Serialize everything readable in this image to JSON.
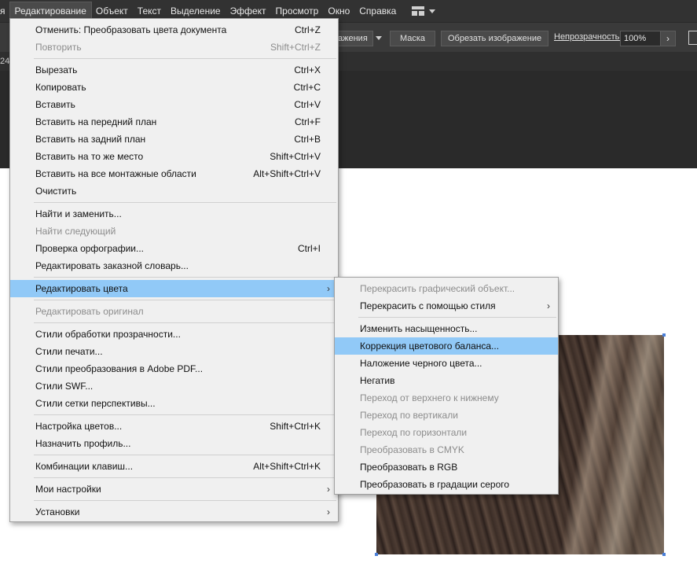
{
  "menubar": {
    "items": [
      "я",
      "Редактирование",
      "Объект",
      "Текст",
      "Выделение",
      "Эффект",
      "Просмотр",
      "Окно",
      "Справка"
    ],
    "active_index": 1
  },
  "controlbar": {
    "partial_button": "ажения",
    "mask_button": "Маска",
    "crop_button": "Обрезать изображение",
    "opacity_label": "Непрозрачность:",
    "opacity_value": "100%",
    "arrow": "›"
  },
  "tabstrip": {
    "partial_text": "24"
  },
  "edit_menu": {
    "items": [
      {
        "label": "Отменить: Преобразовать цвета документа",
        "shortcut": "Ctrl+Z"
      },
      {
        "label": "Повторить",
        "shortcut": "Shift+Ctrl+Z",
        "disabled": true
      },
      {
        "sep": true
      },
      {
        "label": "Вырезать",
        "shortcut": "Ctrl+X"
      },
      {
        "label": "Копировать",
        "shortcut": "Ctrl+C"
      },
      {
        "label": "Вставить",
        "shortcut": "Ctrl+V"
      },
      {
        "label": "Вставить на передний план",
        "shortcut": "Ctrl+F"
      },
      {
        "label": "Вставить на задний план",
        "shortcut": "Ctrl+B"
      },
      {
        "label": "Вставить на то же место",
        "shortcut": "Shift+Ctrl+V"
      },
      {
        "label": "Вставить на все монтажные области",
        "shortcut": "Alt+Shift+Ctrl+V"
      },
      {
        "label": "Очистить",
        "shortcut": ""
      },
      {
        "sep": true
      },
      {
        "label": "Найти и заменить...",
        "shortcut": ""
      },
      {
        "label": "Найти следующий",
        "shortcut": "",
        "disabled": true
      },
      {
        "label": "Проверка орфографии...",
        "shortcut": "Ctrl+I"
      },
      {
        "label": "Редактировать заказной словарь...",
        "shortcut": ""
      },
      {
        "sep": true
      },
      {
        "label": "Редактировать цвета",
        "shortcut": "",
        "submenu": true,
        "highlighted": true
      },
      {
        "sep": true
      },
      {
        "label": "Редактировать оригинал",
        "shortcut": "",
        "disabled": true
      },
      {
        "sep": true
      },
      {
        "label": "Стили обработки прозрачности...",
        "shortcut": ""
      },
      {
        "label": "Стили печати...",
        "shortcut": ""
      },
      {
        "label": "Стили преобразования в Adobe PDF...",
        "shortcut": ""
      },
      {
        "label": "Стили SWF...",
        "shortcut": ""
      },
      {
        "label": "Стили сетки перспективы...",
        "shortcut": ""
      },
      {
        "sep": true
      },
      {
        "label": "Настройка цветов...",
        "shortcut": "Shift+Ctrl+K"
      },
      {
        "label": "Назначить профиль...",
        "shortcut": ""
      },
      {
        "sep": true
      },
      {
        "label": "Комбинации клавиш...",
        "shortcut": "Alt+Shift+Ctrl+K"
      },
      {
        "sep": true
      },
      {
        "label": "Мои настройки",
        "shortcut": "",
        "submenu": true
      },
      {
        "sep": true
      },
      {
        "label": "Установки",
        "shortcut": "",
        "submenu": true
      }
    ]
  },
  "colors_submenu": {
    "items": [
      {
        "label": "Перекрасить графический объект...",
        "disabled": true
      },
      {
        "label": "Перекрасить с помощью стиля",
        "submenu": true
      },
      {
        "sep": true
      },
      {
        "label": "Изменить насыщенность..."
      },
      {
        "label": "Коррекция цветового баланса...",
        "highlighted": true
      },
      {
        "label": "Наложение черного цвета..."
      },
      {
        "label": "Негатив"
      },
      {
        "label": "Переход от верхнего к нижнему",
        "disabled": true
      },
      {
        "label": "Переход по вертикали",
        "disabled": true
      },
      {
        "label": "Переход по горизонтали",
        "disabled": true
      },
      {
        "label": "Преобразовать в CMYK",
        "disabled": true
      },
      {
        "label": "Преобразовать в RGB"
      },
      {
        "label": "Преобразовать в градации серого"
      }
    ]
  },
  "submenu_arrow": "›",
  "colors": {
    "menubar_bg": "#323232",
    "menu_bg": "#f0f0f0",
    "highlight": "#91c9f7",
    "disabled_text": "#8c8c8c"
  }
}
